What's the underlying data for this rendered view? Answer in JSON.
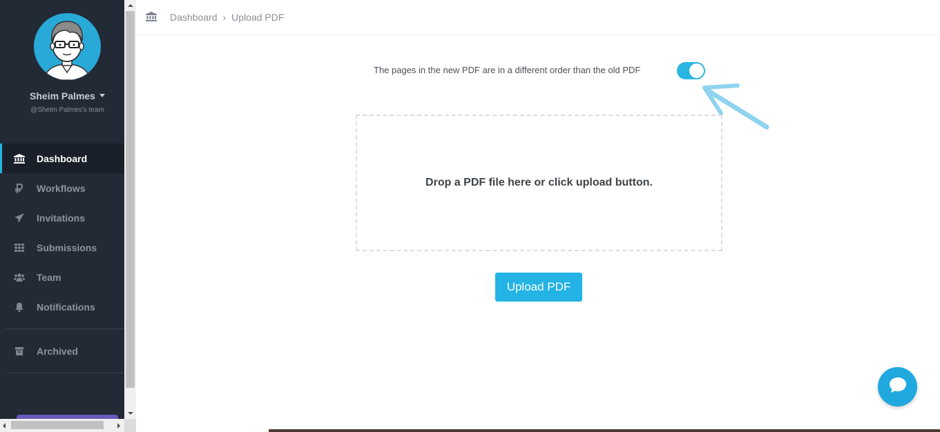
{
  "user": {
    "name": "Sheim Palmes",
    "team": "@Sheim Palmes's team",
    "avatar_color": "#29a9d8"
  },
  "nav": {
    "items": [
      {
        "label": "Dashboard",
        "icon": "bank-icon",
        "active": true
      },
      {
        "label": "Workflows",
        "icon": "workflow-icon",
        "active": false
      },
      {
        "label": "Invitations",
        "icon": "paper-plane-icon",
        "active": false
      },
      {
        "label": "Submissions",
        "icon": "grid-icon",
        "active": false
      },
      {
        "label": "Team",
        "icon": "users-icon",
        "active": false
      },
      {
        "label": "Notifications",
        "icon": "bell-icon",
        "active": false
      }
    ],
    "archived": {
      "label": "Archived",
      "icon": "archive-icon"
    }
  },
  "breadcrumb": {
    "home": "Dashboard",
    "separator": "›",
    "current": "Upload PDF"
  },
  "main": {
    "toggle_label": "The pages in the new PDF are in a different order than the old PDF",
    "toggle_on": true,
    "dropzone_text": "Drop a PDF file here or click upload button.",
    "upload_button": "Upload PDF"
  },
  "colors": {
    "sidebar_bg": "#222a36",
    "accent": "#23b3e4",
    "annotation_arrow": "#8fd3ee"
  }
}
